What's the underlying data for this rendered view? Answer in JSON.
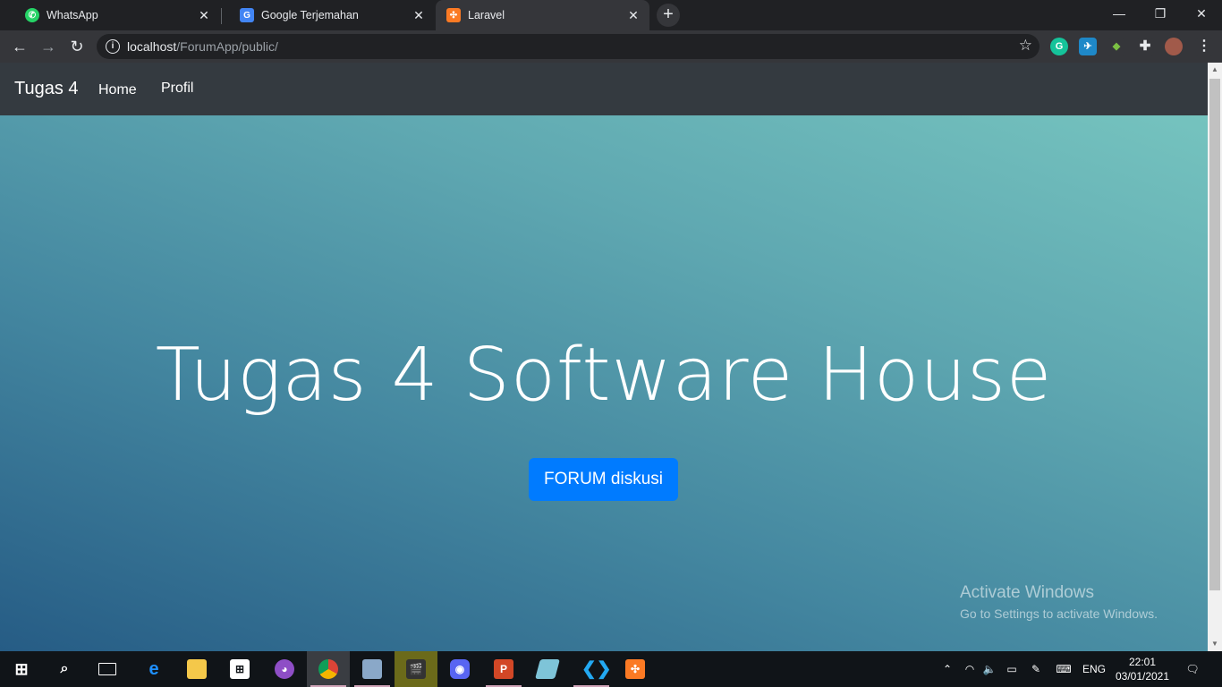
{
  "browser": {
    "tabs": [
      {
        "title": "WhatsApp",
        "favicon": "whatsapp-icon",
        "color": "#25d366",
        "active": false
      },
      {
        "title": "Google Terjemahan",
        "favicon": "google-translate-icon",
        "color": "#4285f4",
        "active": false
      },
      {
        "title": "Laravel",
        "favicon": "xampp-icon",
        "color": "#fb7a24",
        "active": true
      }
    ],
    "address": {
      "host": "localhost",
      "path": "/ForumApp/public/"
    }
  },
  "navbar": {
    "brand": "Tugas 4",
    "links": [
      "Home",
      "Profil"
    ]
  },
  "hero": {
    "title": "Tugas 4 Software House",
    "button_label": "FORUM diskusi",
    "button_color": "#007bff"
  },
  "watermark": {
    "line1": "Activate Windows",
    "line2": "Go to Settings to activate Windows."
  },
  "taskbar": {
    "language": "ENG",
    "time": "22:01",
    "date": "03/01/2021"
  }
}
